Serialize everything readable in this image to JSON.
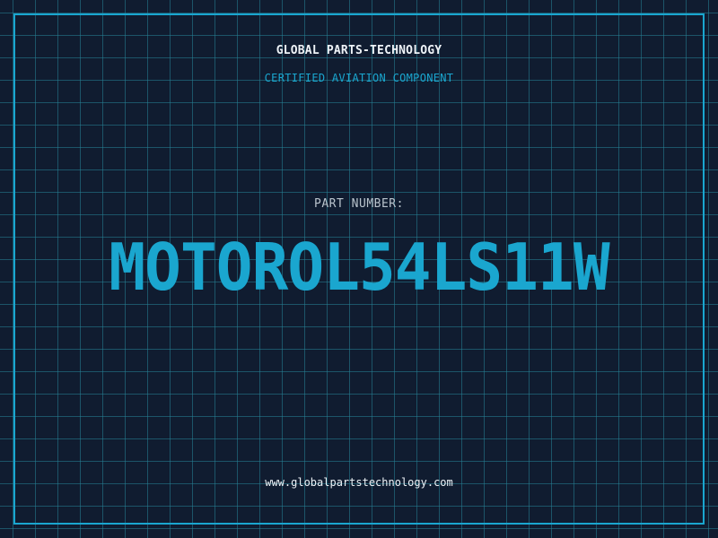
{
  "header": {
    "company": "GLOBAL PARTS-TECHNOLOGY",
    "subtitle": "CERTIFIED AVIATION COMPONENT"
  },
  "main": {
    "label": "PART NUMBER:",
    "part_number": "MOTOROL54LS11W"
  },
  "footer": {
    "website": "www.globalpartstechnology.com"
  },
  "colors": {
    "background": "#101c30",
    "grid": "#1f6e80",
    "accent": "#1aa6cf",
    "text": "#eef3f7",
    "label": "#b9c3cc"
  }
}
